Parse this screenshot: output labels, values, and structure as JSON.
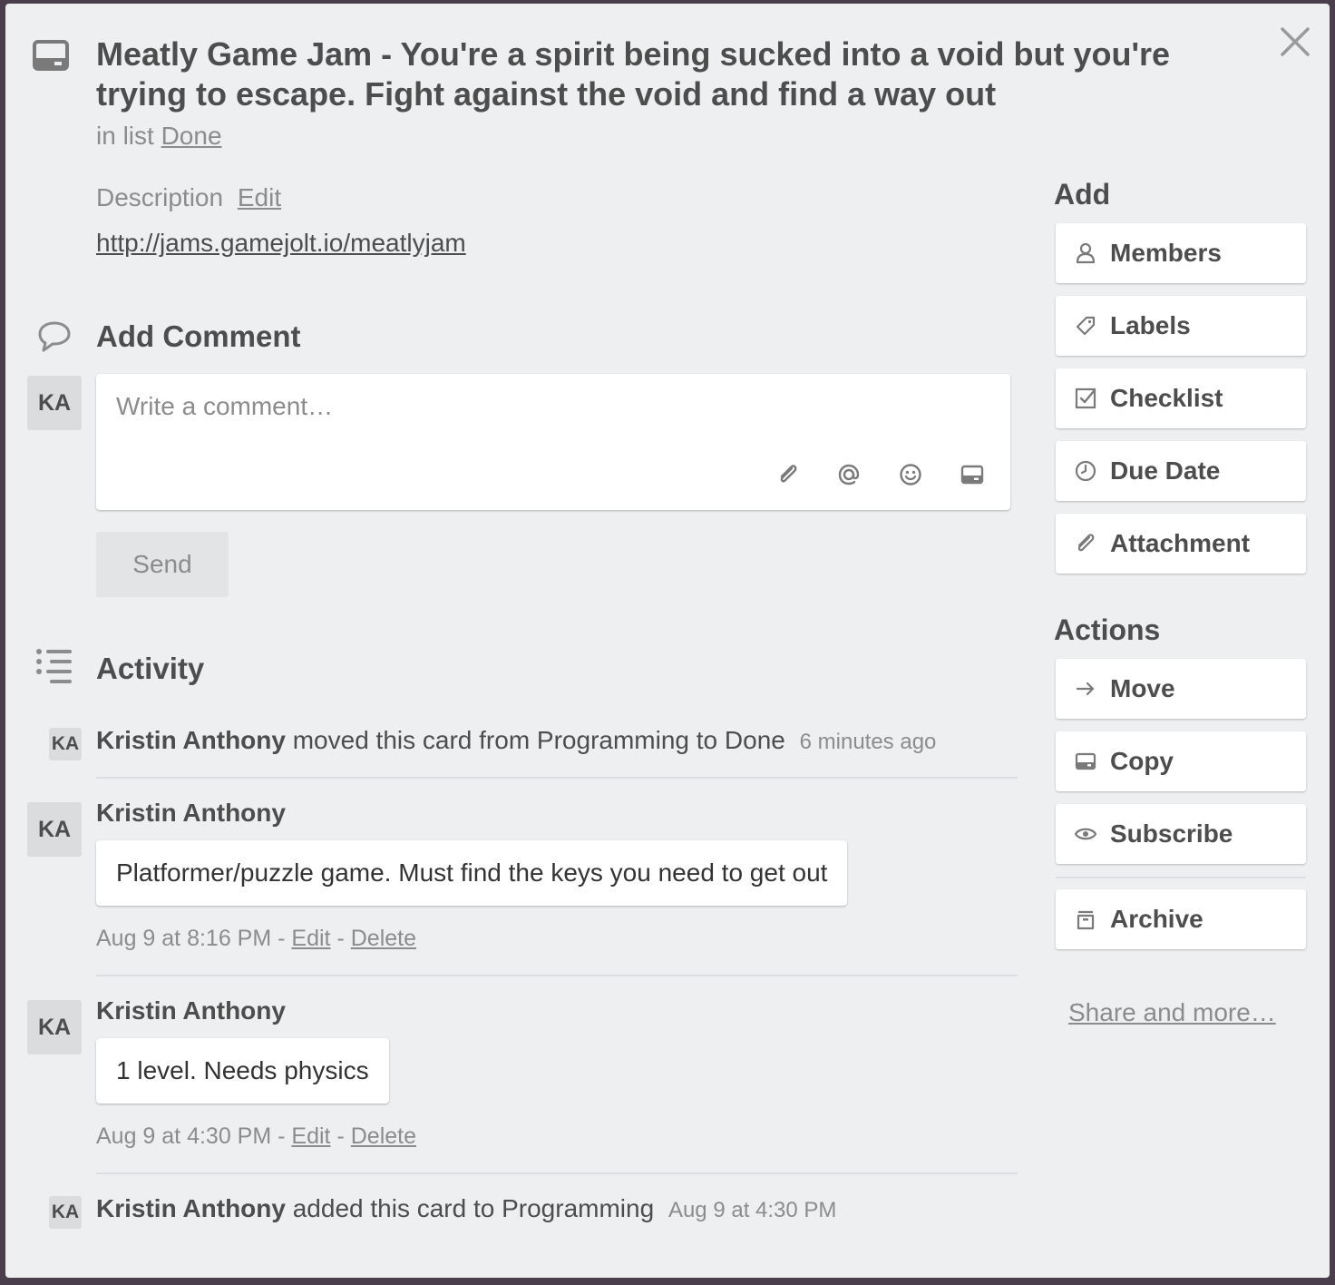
{
  "card": {
    "title": "Meatly Game Jam - You're a spirit being sucked into a void but you're trying to escape. Fight against the void and find a way out",
    "in_list_prefix": "in list",
    "list_name": "Done"
  },
  "description": {
    "label": "Description",
    "edit_label": "Edit",
    "link": "http://jams.gamejolt.io/meatlyjam"
  },
  "add_comment": {
    "title": "Add Comment",
    "avatar": "KA",
    "placeholder": "Write a comment…",
    "send_label": "Send",
    "icons": [
      "paperclip-icon",
      "at-mention-icon",
      "emoji-icon",
      "card-icon"
    ]
  },
  "activity": {
    "title": "Activity",
    "items": [
      {
        "type": "action",
        "avatar": "KA",
        "author": "Kristin Anthony",
        "text": "moved this card from Programming to Done",
        "time": "6 minutes ago"
      },
      {
        "type": "comment",
        "avatar": "KA",
        "author": "Kristin Anthony",
        "comment": "Platformer/puzzle game. Must find the keys you need to get out",
        "date": "Aug 9 at 8:16 PM",
        "sep1": "-",
        "edit_label": "Edit",
        "sep2": "-",
        "delete_label": "Delete"
      },
      {
        "type": "comment",
        "avatar": "KA",
        "author": "Kristin Anthony",
        "comment": "1 level. Needs physics",
        "date": "Aug 9 at 4:30 PM",
        "sep1": "-",
        "edit_label": "Edit",
        "sep2": "-",
        "delete_label": "Delete"
      },
      {
        "type": "action",
        "avatar": "KA",
        "author": "Kristin Anthony",
        "text": "added this card to Programming",
        "time": "Aug 9 at 4:30 PM"
      }
    ]
  },
  "sidebar": {
    "add_title": "Add",
    "add_buttons": [
      {
        "label": "Members",
        "icon": "person-icon"
      },
      {
        "label": "Labels",
        "icon": "tag-icon"
      },
      {
        "label": "Checklist",
        "icon": "checkbox-icon"
      },
      {
        "label": "Due Date",
        "icon": "clock-icon"
      },
      {
        "label": "Attachment",
        "icon": "paperclip-icon"
      }
    ],
    "actions_title": "Actions",
    "action_buttons": [
      {
        "label": "Move",
        "icon": "arrow-right-icon"
      },
      {
        "label": "Copy",
        "icon": "card-icon"
      },
      {
        "label": "Subscribe",
        "icon": "eye-icon"
      },
      {
        "label": "Archive",
        "icon": "archive-icon"
      }
    ],
    "share_label": "Share and more…"
  },
  "colors": {
    "modal_bg": "#edeff0",
    "text": "#4d4d4d",
    "muted": "#8c8c8c",
    "backdrop": "#4a3d4c"
  }
}
